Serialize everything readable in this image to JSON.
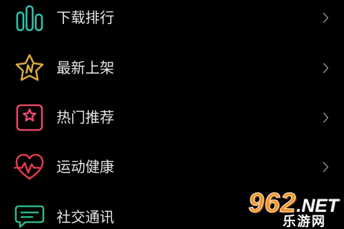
{
  "menu": {
    "items": [
      {
        "label": "下载排行",
        "icon": "bar-chart-icon",
        "icon_color": "#2ec5b3"
      },
      {
        "label": "最新上架",
        "icon": "star-new-icon",
        "icon_color": "#d9ab3e"
      },
      {
        "label": "热门推荐",
        "icon": "star-badge-icon",
        "icon_color": "#e84a67"
      },
      {
        "label": "运动健康",
        "icon": "heart-pulse-icon",
        "icon_color": "#e8384f"
      },
      {
        "label": "社交通讯",
        "icon": "chat-bubble-icon",
        "icon_color": "#2cb98b"
      }
    ],
    "chevron_icon": "chevron-right-icon"
  },
  "theme": {
    "background": "#000000",
    "text": "#e6e6e6",
    "chevron": "#8c8c8c"
  },
  "watermark": {
    "number": "962",
    "domain": ".NET",
    "name": "乐游网",
    "number_color": "#f7931e"
  }
}
